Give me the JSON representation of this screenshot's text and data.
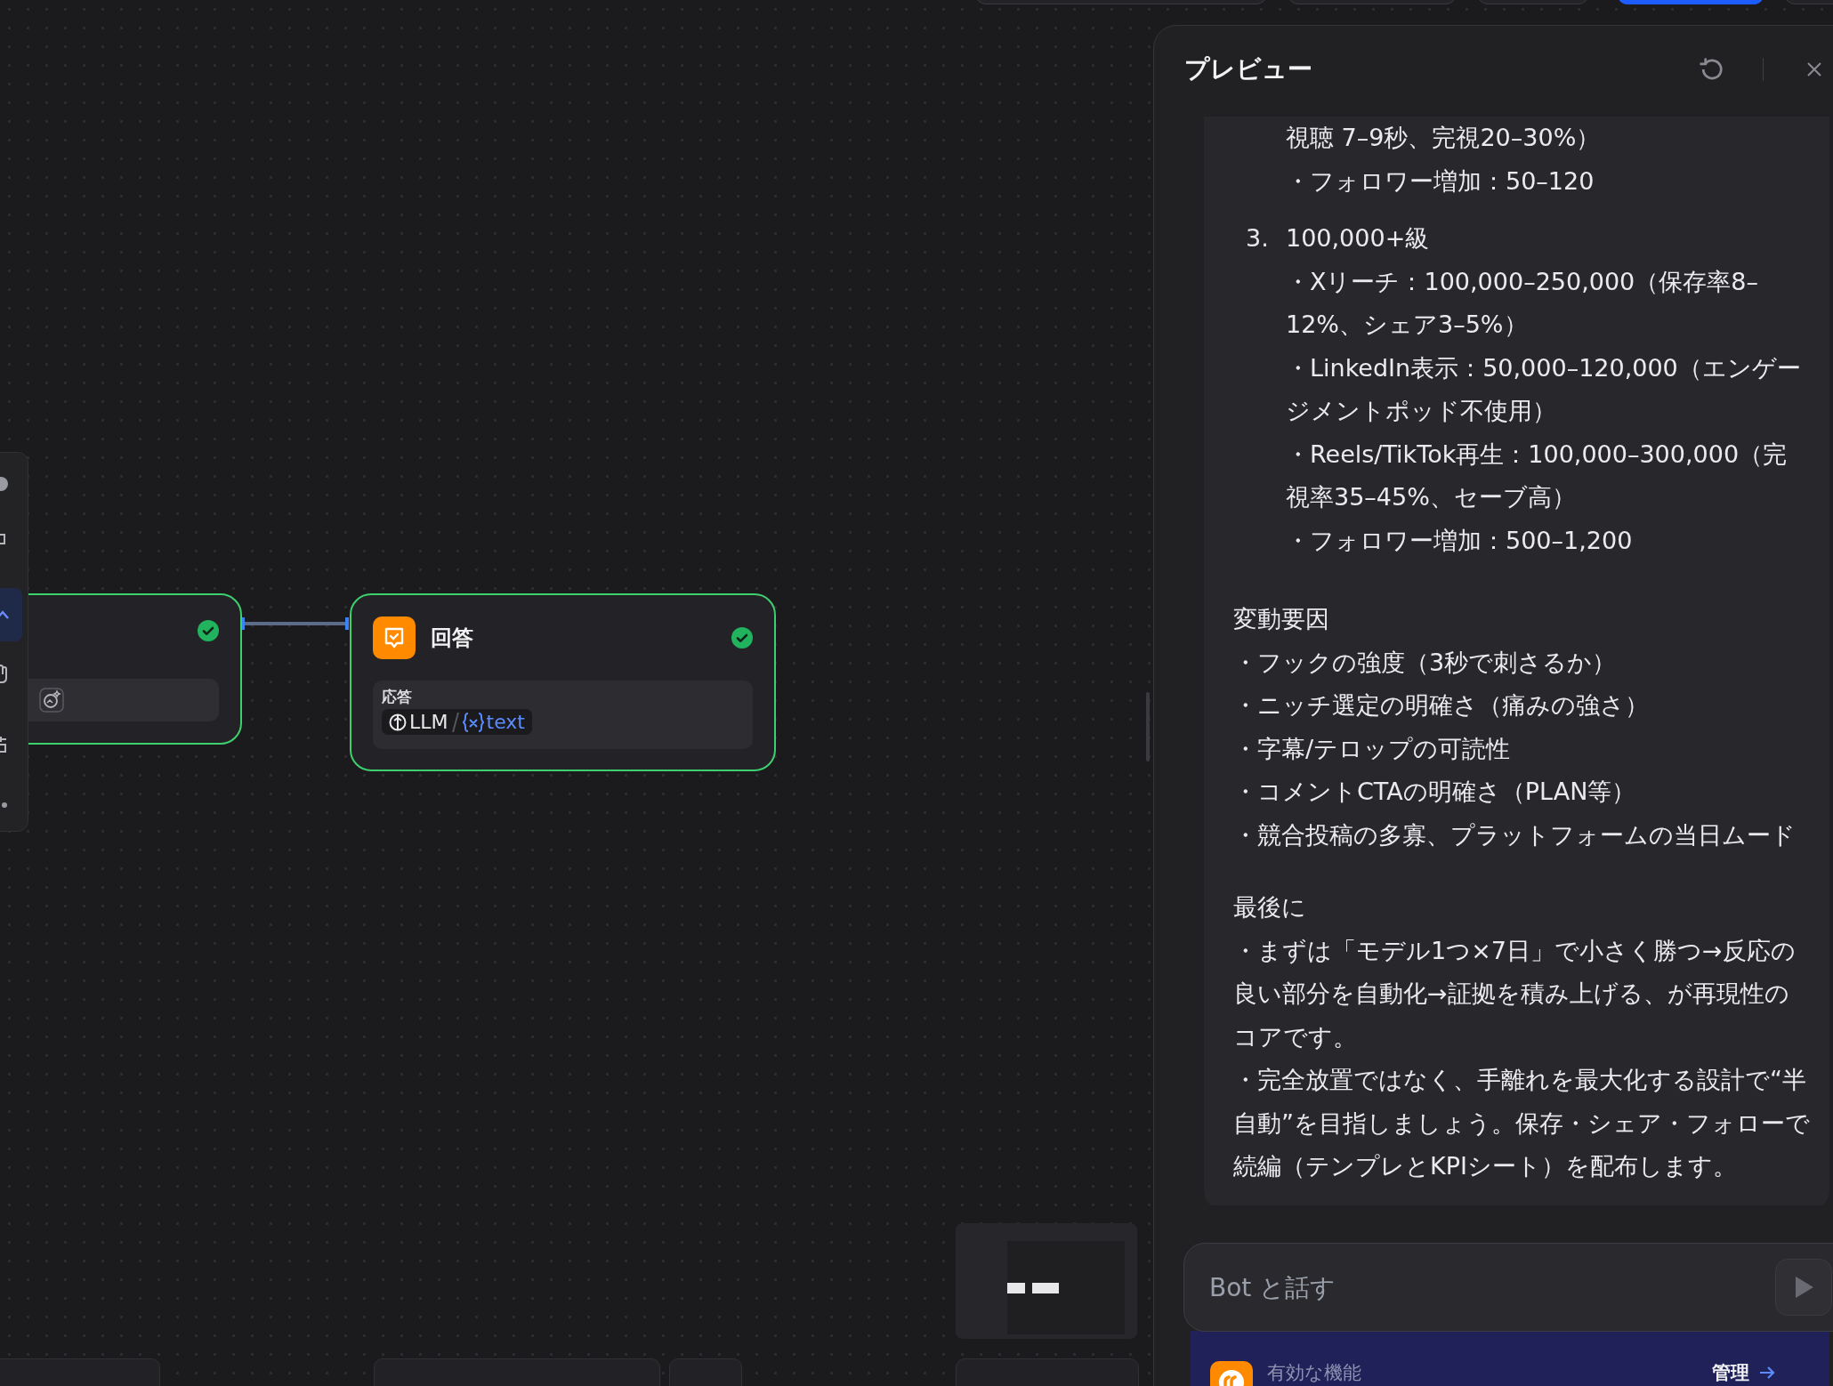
{
  "canvas": {
    "nodes": [
      {
        "kind": "partial",
        "done": true
      },
      {
        "kind": "answer",
        "done": true,
        "title": "回答",
        "field_label": "応答",
        "source": "LLM",
        "variable": "text"
      }
    ]
  },
  "preview": {
    "title": "プレビュー",
    "message": {
      "blocks": [
        {
          "kind": "indented",
          "text": "視聴 7–9秒、完視20–30%）"
        },
        {
          "kind": "indented",
          "text": "・フォロワー増加：50–120"
        },
        {
          "kind": "numbered",
          "number": "3.",
          "title": "100,000+級",
          "lines": [
            "・Xリーチ：100,000–250,000（保存率8–12%、シェア3–5%）",
            "・LinkedIn表示：50,000–120,000（エンゲージメントポッド不使用）",
            "・Reels/TikTok再生：100,000–300,000（完視率35–45%、セーブ高）",
            "・フォロワー増加：500–1,200"
          ]
        },
        {
          "kind": "section",
          "title": "変動要因",
          "lines": [
            "・フックの強度（3秒で刺さるか）",
            "・ニッチ選定の明確さ（痛みの強さ）",
            "・字幕/テロップの可読性",
            "・コメントCTAの明確さ（PLAN等）",
            "・競合投稿の多寡、プラットフォームの当日ムード"
          ]
        },
        {
          "kind": "section",
          "title": "最後に",
          "lines": [
            "・まずは「モデル1つ×7日」で小さく勝つ→反応の良い部分を自動化→証拠を積み上げる、が再現性のコアです。",
            "・完全放置ではなく、手離れを最大化する設計で“半自動”を目指しましょう。保存・シェア・フォローで続編（テンプレとKPIシート）を配布します。"
          ]
        }
      ]
    },
    "input": {
      "placeholder": "Bot と話す"
    },
    "features": {
      "label": "有効な機能",
      "action": "管理"
    }
  }
}
